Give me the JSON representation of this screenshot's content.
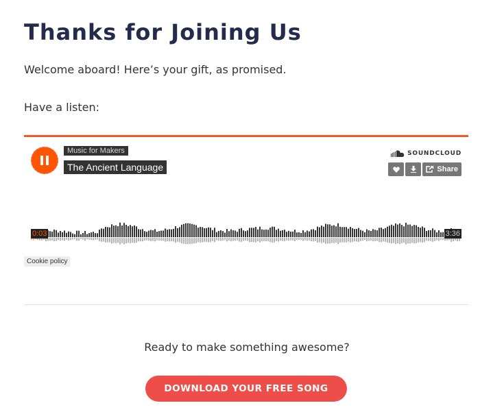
{
  "page": {
    "title": "Thanks for Joining Us",
    "welcome": "Welcome aboard! Here’s your gift, as promised.",
    "listen": "Have a listen:"
  },
  "player": {
    "artist": "Music for Makers",
    "track_title": "The Ancient Language",
    "brand": "SOUNDCLOUD",
    "share_label": "Share",
    "time_current": "0:03",
    "time_total": "3:36",
    "cookie_policy": "Cookie policy",
    "accent_color": "#ff5500",
    "progress_fraction": 0.014
  },
  "cta": {
    "text": "Ready to make something awesome?",
    "button_label": "DOWNLOAD YOUR FREE SONG",
    "button_color": "#ee4e4a"
  }
}
